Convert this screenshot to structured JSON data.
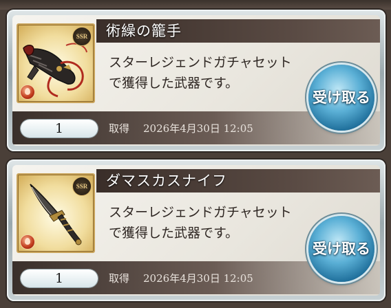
{
  "items": [
    {
      "name": "術繰の籠手",
      "description": "スターレジェンドガチャセットで獲得した武器です。",
      "quantity": "1",
      "obtained_label": "取得",
      "obtained_date": "2026年4月30日 12:05",
      "rarity": "SSR",
      "element_icon": "fire-element-icon",
      "weapon_icon": "gauntlet-weapon-icon",
      "button_label": "受け取る"
    },
    {
      "name": "ダマスカスナイフ",
      "description": "スターレジェンドガチャセットで獲得した武器です。",
      "quantity": "1",
      "obtained_label": "取得",
      "obtained_date": "2026年4月30日 12:05",
      "rarity": "SSR",
      "element_icon": "fire-element-icon",
      "weapon_icon": "dagger-weapon-icon",
      "button_label": "受け取る"
    }
  ],
  "colors": {
    "title_bar": "#3a2e29",
    "button": "#5bb0d6",
    "thumb_bg": "#f1dd9e"
  }
}
